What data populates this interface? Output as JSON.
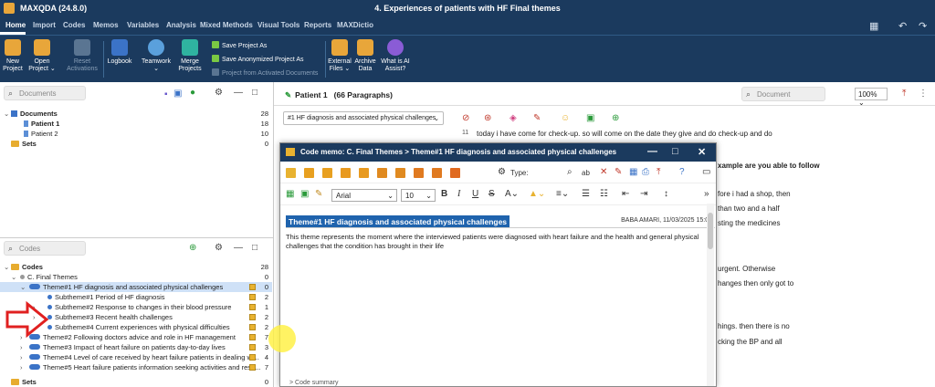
{
  "window": {
    "app_title": "MAXQDA (24.8.0)",
    "doc_title": "4. Experiences of patients with HF Final themes"
  },
  "menu": [
    "Home",
    "Import",
    "Codes",
    "Memos",
    "Variables",
    "Analysis",
    "Mixed Methods",
    "Visual Tools",
    "Reports",
    "MAXDictio"
  ],
  "ribbon": {
    "new_project": "New\nProject",
    "open_project": "Open\nProject ⌄",
    "reset_activations": "Reset\nActivations",
    "logbook": "Logbook",
    "teamwork": "Teamwork\n⌄",
    "merge_projects": "Merge\nProjects",
    "save_as": "Save Project As",
    "save_anon": "Save Anonymized Project As",
    "project_from_activated": "Project from Activated Documents",
    "external_files": "External\nFiles ⌄",
    "archive_data": "Archive\nData",
    "what_is_ai": "What is AI\nAssist?"
  },
  "documents_panel": {
    "search_placeholder": "Documents",
    "rows": [
      {
        "label": "Documents",
        "count": "28"
      },
      {
        "label": "Patient 1",
        "count": "18"
      },
      {
        "label": "Patient 2",
        "count": "10"
      },
      {
        "label": "Sets",
        "count": "0"
      }
    ]
  },
  "codes_panel": {
    "search_placeholder": "Codes",
    "rows": [
      {
        "label": "Codes",
        "count": "28"
      },
      {
        "label": "C. Final Themes",
        "count": "0"
      },
      {
        "label": "Theme#1 HF diagnosis and associated physical challenges",
        "count": "0"
      },
      {
        "label": "Subtheme#1 Period of HF diagnosis",
        "count": "2"
      },
      {
        "label": "Subtheme#2 Response to changes in their blood pressure",
        "count": "1"
      },
      {
        "label": "Subtheme#3 Recent health challenges",
        "count": "2"
      },
      {
        "label": "Subtheme#4 Current experiences with physical difficulties",
        "count": "2"
      },
      {
        "label": "Theme#2 Following doctors advice and role in HF management",
        "count": "7"
      },
      {
        "label": "Theme#3 Impact of heart failure on patients day-to-day lives",
        "count": "3"
      },
      {
        "label": "Theme#4 Level of care received  by heart failure patients in  dealing wi...",
        "count": "4"
      },
      {
        "label": "Theme#5 Heart failure patients information seeking activities and reso...",
        "count": "7"
      },
      {
        "label": "Sets",
        "count": "0"
      }
    ]
  },
  "document_view": {
    "title": "Patient 1",
    "paragraphs": "(66 Paragraphs)",
    "search_placeholder": "Document",
    "zoom": "100%",
    "code_selector": "#1 HF diagnosis and associated physical challenges",
    "para_num": "11",
    "line1": "today i have come for check-up. so will come on the date they give and do check-up and do",
    "bg_texts": [
      "xample are you able to follow",
      "fore i had a shop, then",
      "than two and a half",
      "sting the medicines",
      "urgent. Otherwise",
      "hanges then only got to",
      "hings. then there is no",
      "cking the BP and all"
    ]
  },
  "memo": {
    "window_title": "Code memo: C. Final Themes > Theme#1 HF diagnosis and associated physical challenges",
    "type_label": "Type:",
    "font": "Arial",
    "size": "10",
    "title": "Theme#1 HF diagnosis and associated physical challenges",
    "info": "BABA  AMARI, 11/03/2025 15:08",
    "body": "This theme represents the moment where the interviewed patients were diagnosed with heart failure and the health and general physical challenges that the condition has brought in their life",
    "footer": "> Code summary"
  },
  "colors": {
    "chrome": "#1b3a5e",
    "highlight": "#1f63ad",
    "arrow": "#e02020"
  }
}
